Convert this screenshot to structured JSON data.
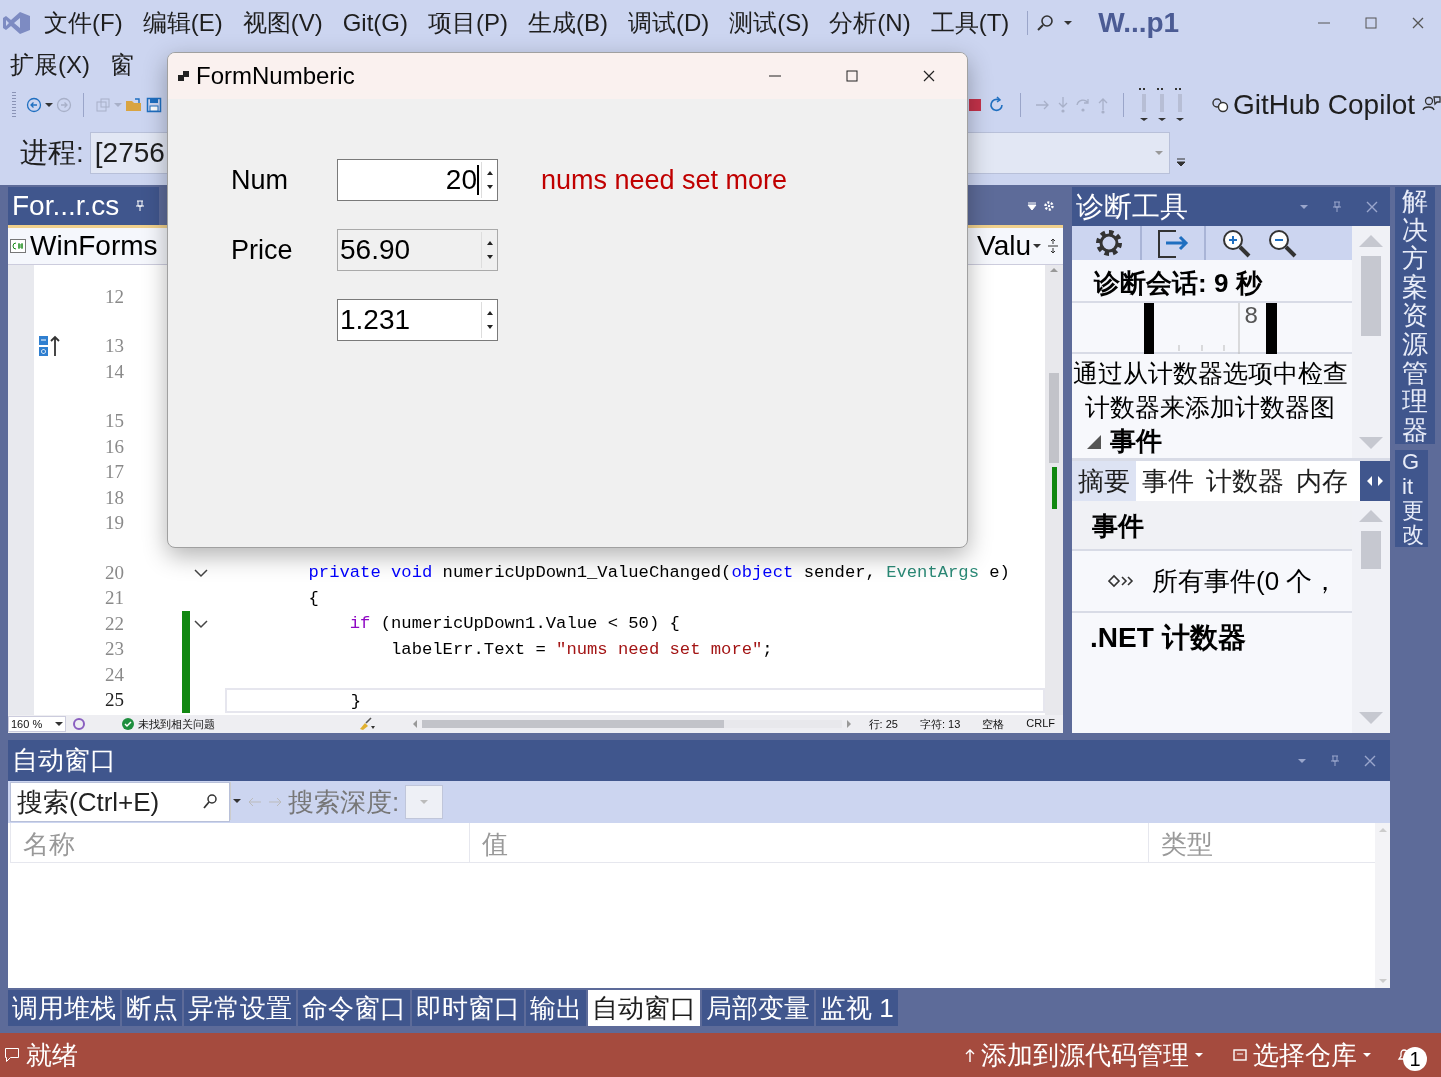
{
  "menu_bar": {
    "rows": [
      [
        "文件(F)",
        "编辑(E)",
        "视图(V)",
        "Git(G)",
        "项目(P)",
        "生成(B)",
        "调试(D)",
        "测试(S)",
        "分析(N)",
        "工具(T)"
      ],
      [
        "扩展(X)",
        "窗"
      ]
    ],
    "title": "W...p1"
  },
  "toolbar": {
    "copilot": "GitHub Copilot"
  },
  "process": {
    "label": "进程:",
    "value": "[2756"
  },
  "editor": {
    "tab": "For...r.cs",
    "project_nav": "WinForms",
    "member_nav": "Valu",
    "lines": [
      {
        "number": "12"
      },
      {
        "number": "13",
        "codelens": true,
        "margin_icon": true
      },
      {
        "number": "14"
      },
      {
        "number": "15",
        "codelens": true
      },
      {
        "number": "16"
      },
      {
        "number": "17"
      },
      {
        "number": "18"
      },
      {
        "number": "19"
      },
      {
        "number": "20",
        "codelens": true,
        "fold": true,
        "tokens": [
          {
            "kind": "keyword",
            "text": "        private void"
          },
          {
            "kind": "plain",
            "text": " numericUpDown1_ValueChanged("
          },
          {
            "kind": "keyword",
            "text": "object"
          },
          {
            "kind": "plain",
            "text": " sender, "
          },
          {
            "kind": "type",
            "text": "EventArgs"
          },
          {
            "kind": "plain",
            "text": " e)"
          }
        ]
      },
      {
        "number": "21",
        "tokens": [
          {
            "kind": "plain",
            "text": "        {"
          }
        ]
      },
      {
        "number": "22",
        "fold": true,
        "changed": true,
        "tokens": [
          {
            "kind": "control",
            "text": "            if"
          },
          {
            "kind": "plain",
            "text": " (numericUpDown1.Value < 50) {"
          }
        ]
      },
      {
        "number": "23",
        "changed": true,
        "tokens": [
          {
            "kind": "plain",
            "text": "                labelErr.Text = "
          },
          {
            "kind": "string",
            "text": "\"nums need set more\""
          },
          {
            "kind": "plain",
            "text": ";"
          }
        ]
      },
      {
        "number": "24",
        "changed": true
      },
      {
        "number": "25",
        "changed": true,
        "current": true,
        "tokens": [
          {
            "kind": "plain",
            "text": "            }"
          }
        ]
      }
    ],
    "status": {
      "zoom": "160 %",
      "issues": "未找到相关问题",
      "line": "行: 25",
      "char": "字符: 13",
      "spacing": "空格",
      "eol": "CRLF"
    }
  },
  "diagnostics": {
    "title": "诊断工具",
    "session": "诊断会话: 9 秒",
    "timeline_label": "8",
    "hint": "通过从计数器选项中检查计数器来添加计数器图",
    "events_heading": "事件",
    "tabs": [
      {
        "label": "摘要",
        "selected": true
      },
      {
        "label": "事件",
        "selected": false
      },
      {
        "label": "计数器",
        "selected": false
      },
      {
        "label": "内存",
        "selected": false
      }
    ],
    "section": "事件",
    "all_events": "所有事件(0 个，",
    "dotnet": ".NET 计数器"
  },
  "side_tabs": [
    "解决方案资源管理器",
    "Git 更改"
  ],
  "autos": {
    "title": "自动窗口",
    "placeholder": "搜索(Ctrl+E)",
    "depth_label": "搜索深度:",
    "columns": [
      "名称",
      "值",
      "类型"
    ]
  },
  "bottom_tabs": [
    {
      "label": "调用堆栈",
      "selected": false
    },
    {
      "label": "断点",
      "selected": false
    },
    {
      "label": "异常设置",
      "selected": false
    },
    {
      "label": "命令窗口",
      "selected": false
    },
    {
      "label": "即时窗口",
      "selected": false
    },
    {
      "label": "输出",
      "selected": false
    },
    {
      "label": "自动窗口",
      "selected": true
    },
    {
      "label": "局部变量",
      "selected": false
    },
    {
      "label": "监视 1",
      "selected": false
    }
  ],
  "status_bar": {
    "state": "就绪",
    "add_source": "添加到源代码管理",
    "repo": "选择仓库",
    "notifications": "1"
  },
  "form": {
    "title": "FormNumberic",
    "error": "nums need set more",
    "fields": [
      {
        "label": "Num",
        "value": "20",
        "kind": "right-aligned",
        "focused": true,
        "read_only": false
      },
      {
        "label": "Price",
        "value": "56.90",
        "kind": "left-aligned",
        "focused": false,
        "read_only": true
      },
      {
        "value": "1.231",
        "kind": "left-aligned",
        "focused": false,
        "read_only": false
      }
    ]
  }
}
